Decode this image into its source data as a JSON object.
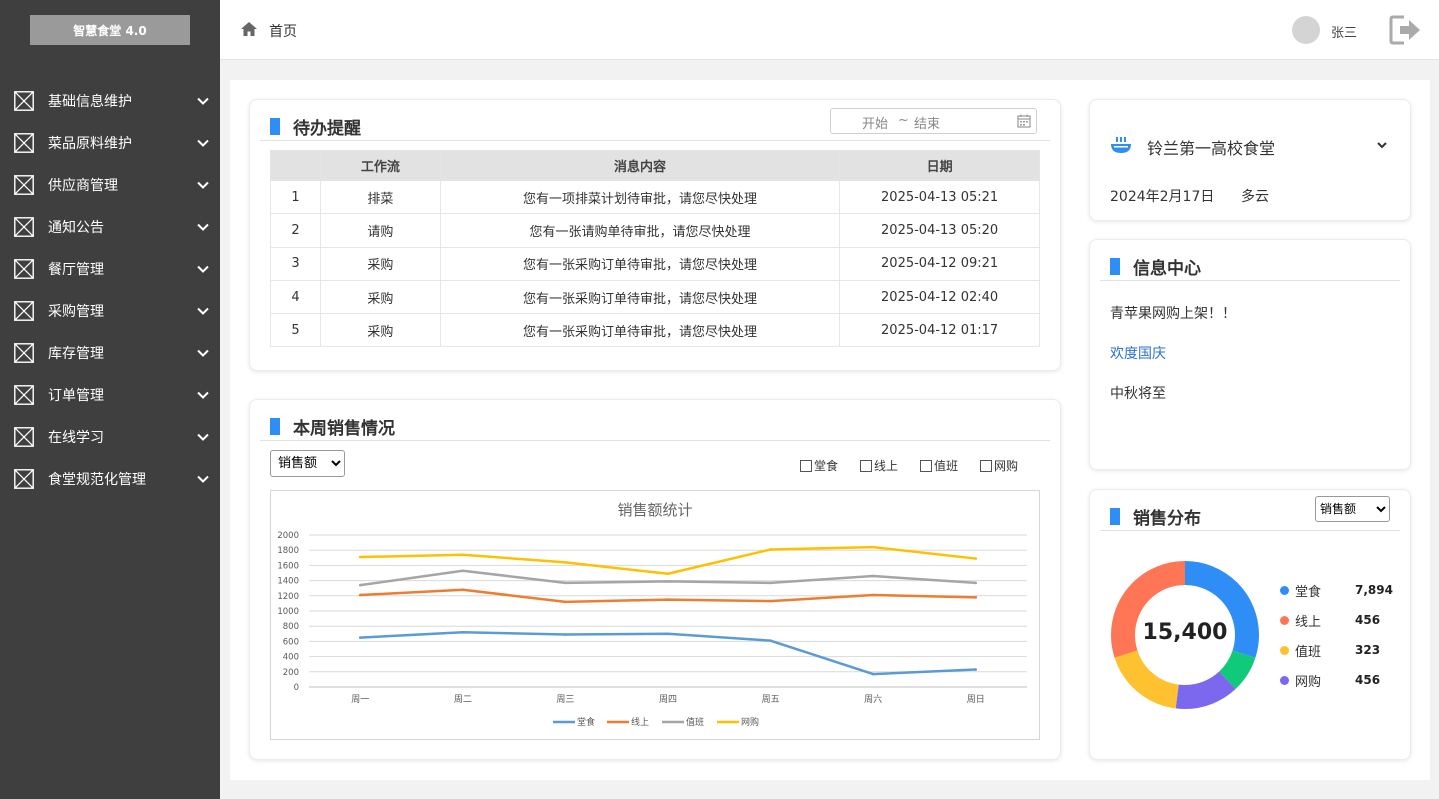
{
  "app": {
    "logo": "智慧食堂 4.0"
  },
  "sidebar": {
    "items": [
      {
        "label": "基础信息维护"
      },
      {
        "label": "菜品原料维护"
      },
      {
        "label": "供应商管理"
      },
      {
        "label": "通知公告"
      },
      {
        "label": "餐厅管理"
      },
      {
        "label": "采购管理"
      },
      {
        "label": "库存管理"
      },
      {
        "label": "订单管理"
      },
      {
        "label": "在线学习"
      },
      {
        "label": "食堂规范化管理"
      }
    ]
  },
  "header": {
    "breadcrumb": "首页",
    "user": "张三"
  },
  "todo": {
    "title": "待办提醒",
    "date_start": "开始",
    "date_sep": "~",
    "date_end": "结束",
    "columns": [
      "",
      "工作流",
      "消息内容",
      "日期"
    ],
    "rows": [
      [
        "1",
        "排菜",
        "您有一项排菜计划待审批，请您尽快处理",
        "2025-04-13 05:21"
      ],
      [
        "2",
        "请购",
        "您有一张请购单待审批，请您尽快处理",
        "2025-04-13 05:20"
      ],
      [
        "3",
        "采购",
        "您有一张采购订单待审批，请您尽快处理",
        "2025-04-12 09:21"
      ],
      [
        "4",
        "采购",
        "您有一张采购订单待审批，请您尽快处理",
        "2025-04-12 02:40"
      ],
      [
        "5",
        "采购",
        "您有一张采购订单待审批，请您尽快处理",
        "2025-04-12 01:17"
      ]
    ]
  },
  "weekly": {
    "title": "本周销售情况",
    "select_value": "销售额",
    "filters": [
      "堂食",
      "线上",
      "值班",
      "网购"
    ]
  },
  "chart_data": {
    "type": "line",
    "title": "销售额统计",
    "categories": [
      "周一",
      "周二",
      "周三",
      "周四",
      "周五",
      "周六",
      "周日"
    ],
    "ylim": [
      0,
      2000
    ],
    "yticks": [
      0,
      200,
      400,
      600,
      800,
      1000,
      1200,
      1400,
      1600,
      1800,
      2000
    ],
    "grid": true,
    "legend": "bottom",
    "series": [
      {
        "name": "堂食",
        "color": "#5b9bd5",
        "values": [
          650,
          720,
          690,
          700,
          610,
          170,
          230
        ]
      },
      {
        "name": "线上",
        "color": "#ed7d31",
        "values": [
          1210,
          1280,
          1120,
          1150,
          1130,
          1210,
          1180
        ]
      },
      {
        "name": "值班",
        "color": "#a5a5a5",
        "values": [
          1340,
          1530,
          1370,
          1390,
          1370,
          1460,
          1370
        ]
      },
      {
        "name": "网购",
        "color": "#ffc000",
        "values": [
          1710,
          1740,
          1640,
          1490,
          1810,
          1840,
          1690
        ]
      }
    ]
  },
  "canteen": {
    "name": "铃兰第一高校食堂",
    "date": "2024年2月17日",
    "weather": "多云"
  },
  "info": {
    "title": "信息中心",
    "notices": [
      {
        "text": "青苹果网购上架！！"
      },
      {
        "text": "欢度国庆"
      },
      {
        "text": "中秋将至"
      }
    ]
  },
  "distribution": {
    "title": "销售分布",
    "select_value": "销售额",
    "total": "15,400",
    "items": [
      {
        "name": "堂食",
        "value": "7,894",
        "color": "#2e8ef5"
      },
      {
        "name": "线上",
        "value": "456",
        "color": "#ff7657"
      },
      {
        "name": "值班",
        "value": "323",
        "color": "#fec12f"
      },
      {
        "name": "网购",
        "value": "456",
        "color": "#7b68ee"
      }
    ],
    "ring_segments": [
      {
        "color": "#2e8ef5",
        "percent": 30
      },
      {
        "color": "#10c97b",
        "percent": 8
      },
      {
        "color": "#7b68ee",
        "percent": 14
      },
      {
        "color": "#fec12f",
        "percent": 18
      },
      {
        "color": "#ff7657",
        "percent": 30
      }
    ]
  }
}
